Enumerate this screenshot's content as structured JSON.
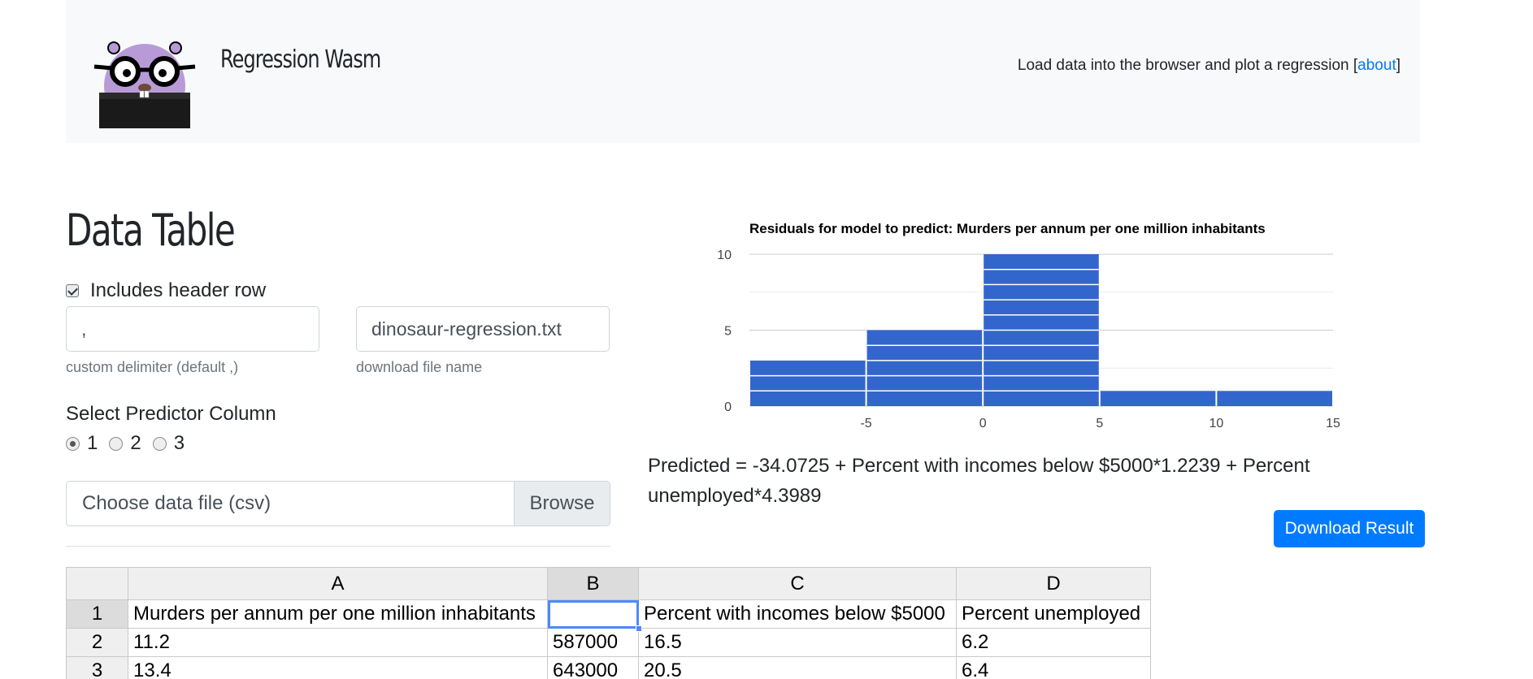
{
  "header": {
    "app_title": "Regression Wasm",
    "tagline_prefix": "Load data into the browser and plot a regression [",
    "about_link": "about",
    "tagline_suffix": "]"
  },
  "page": {
    "heading": "Data Table",
    "includes_header_row_label": "Includes header row",
    "includes_header_row_checked": true,
    "delimiter_value": ",",
    "delimiter_help": "custom delimiter (default ,)",
    "filename_value": "dinosaur-regression.txt",
    "filename_help": "download file name",
    "predictor_label": "Select Predictor Column",
    "predictor_options": [
      "1",
      "2",
      "3"
    ],
    "predictor_selected": "1",
    "file_placeholder": "Choose data file (csv)",
    "browse_label": "Browse",
    "formula": "Predicted = -34.0725 + Percent with incomes below $5000*1.2239 + Percent unemployed*4.3989",
    "download_label": "Download Result"
  },
  "spreadsheet": {
    "columns": [
      "A",
      "B",
      "C",
      "D"
    ],
    "rows": [
      {
        "num": "1",
        "cells": [
          "Murders per annum per one million inhabitants",
          "",
          "Percent with incomes below $5000",
          "Percent unemployed"
        ]
      },
      {
        "num": "2",
        "cells": [
          "11.2",
          "587000",
          "16.5",
          "6.2"
        ]
      },
      {
        "num": "3",
        "cells": [
          "13.4",
          "643000",
          "20.5",
          "6.4"
        ]
      }
    ],
    "active_cell": "B1"
  },
  "chart_data": {
    "type": "bar",
    "title": "Residuals for model to predict: Murders per annum per one million inhabitants",
    "bins": [
      {
        "x0": -10,
        "x1": -5,
        "count": 3
      },
      {
        "x0": -5,
        "x1": 0,
        "count": 5
      },
      {
        "x0": 0,
        "x1": 5,
        "count": 10
      },
      {
        "x0": 5,
        "x1": 10,
        "count": 1
      },
      {
        "x0": 10,
        "x1": 15,
        "count": 1
      }
    ],
    "x_ticks": [
      -5,
      0,
      5,
      10,
      15
    ],
    "y_ticks": [
      0,
      5,
      10
    ],
    "xlim": [
      -10,
      15
    ],
    "ylim": [
      0,
      10
    ],
    "bar_color": "#3366cc",
    "grid": true
  }
}
